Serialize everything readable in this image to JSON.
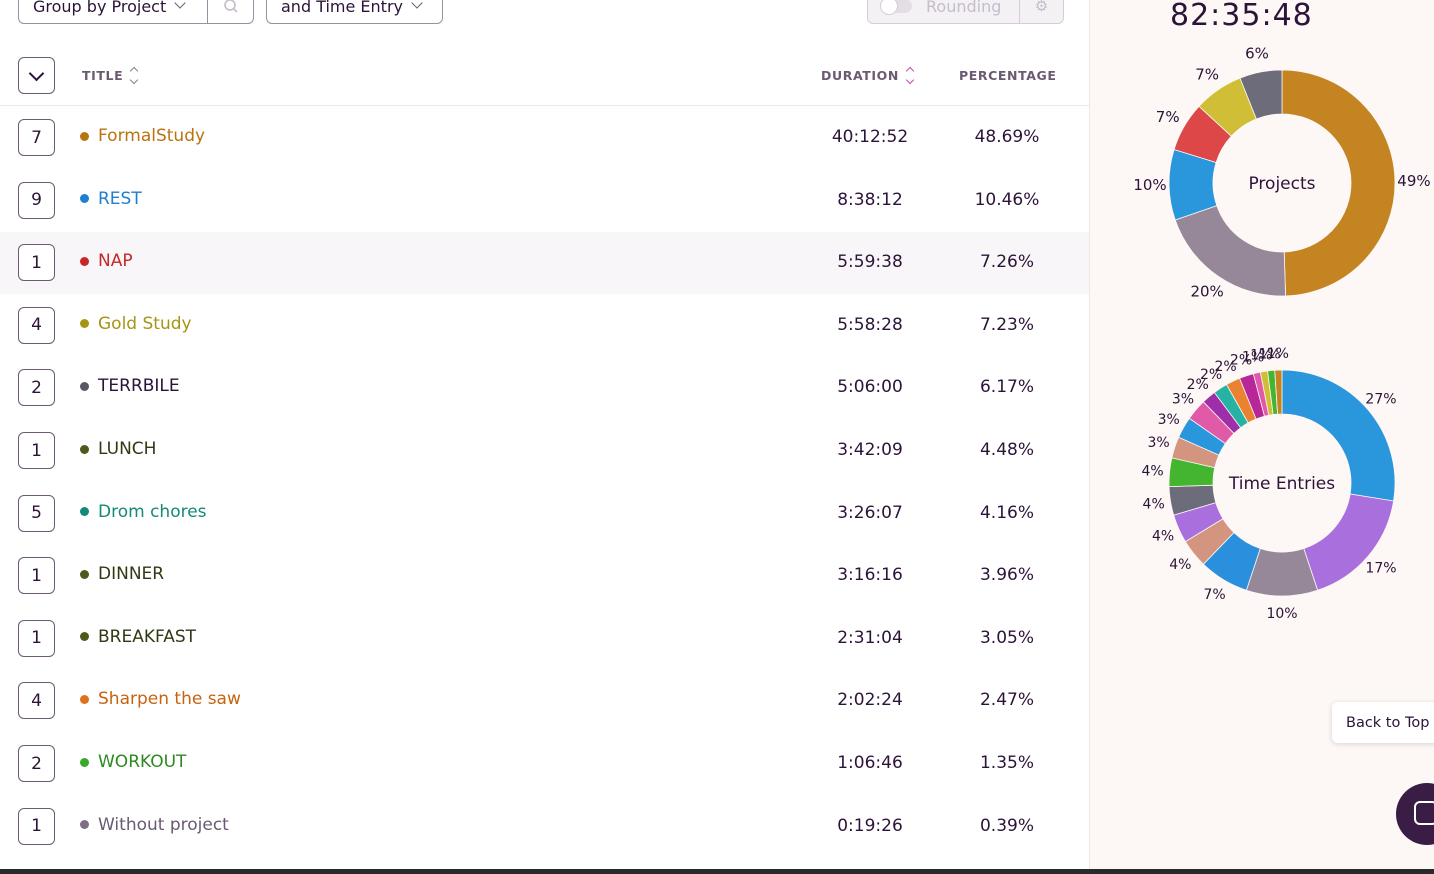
{
  "filters": {
    "group_by": "Group by Project",
    "sub_group": "and Time Entry",
    "rounding": "Rounding"
  },
  "table": {
    "headers": {
      "title": "TITLE",
      "duration": "DURATION",
      "percentage": "PERCENTAGE"
    },
    "rows": [
      {
        "count": "7",
        "name": "FormalStudy",
        "color": "#b9730f",
        "duration": "40:12:52",
        "percentage": "48.69%"
      },
      {
        "count": "9",
        "name": "REST",
        "color": "#1f7ecf",
        "duration": "8:38:12",
        "percentage": "10.46%"
      },
      {
        "count": "1",
        "name": "NAP",
        "color": "#c62828",
        "duration": "5:59:38",
        "percentage": "7.26%"
      },
      {
        "count": "4",
        "name": "Gold Study",
        "color": "#a69414",
        "duration": "5:58:28",
        "percentage": "7.23%"
      },
      {
        "count": "2",
        "name": "TERRBILE",
        "color": "#2c1338",
        "dot": "#5b5866",
        "duration": "5:06:00",
        "percentage": "6.17%"
      },
      {
        "count": "1",
        "name": "LUNCH",
        "color": "#2f3a14",
        "dot": "#4d5a1c",
        "duration": "3:42:09",
        "percentage": "4.48%"
      },
      {
        "count": "5",
        "name": "Drom chores",
        "color": "#128a78",
        "duration": "3:26:07",
        "percentage": "4.16%"
      },
      {
        "count": "1",
        "name": "DINNER",
        "color": "#2f3a14",
        "dot": "#4d5a1c",
        "duration": "3:16:16",
        "percentage": "3.96%"
      },
      {
        "count": "1",
        "name": "BREAKFAST",
        "color": "#2f3a14",
        "dot": "#4d5a1c",
        "duration": "2:31:04",
        "percentage": "3.05%"
      },
      {
        "count": "4",
        "name": "Sharpen the saw",
        "color": "#c7630f",
        "dot": "#e0711b",
        "duration": "2:02:24",
        "percentage": "2.47%"
      },
      {
        "count": "2",
        "name": "WORKOUT",
        "color": "#2c8a1f",
        "dot": "#3aa82a",
        "duration": "1:06:46",
        "percentage": "1.35%"
      },
      {
        "count": "1",
        "name": "Without project",
        "color": "#6b5a72",
        "dot": "#7d6f85",
        "duration": "0:19:26",
        "percentage": "0.39%"
      }
    ]
  },
  "sidebar": {
    "total_time": "82:35:48",
    "back_to_top": "Back to Top"
  },
  "chart_data": [
    {
      "type": "pie",
      "title": "Projects",
      "slices": [
        {
          "label": "49%",
          "value": 49,
          "color": "#c58422"
        },
        {
          "label": "20%",
          "value": 20,
          "color": "#978899"
        },
        {
          "label": "10%",
          "value": 10,
          "color": "#2a96dc"
        },
        {
          "label": "7%",
          "value": 7,
          "color": "#dd4747"
        },
        {
          "label": "7%",
          "value": 7,
          "color": "#d0bf36"
        },
        {
          "label": "6%",
          "value": 6,
          "color": "#6d6c7a"
        }
      ]
    },
    {
      "type": "pie",
      "title": "Time Entries",
      "slices": [
        {
          "label": "27%",
          "value": 27,
          "color": "#2a96dc"
        },
        {
          "label": "17%",
          "value": 17,
          "color": "#a970dd"
        },
        {
          "label": "10%",
          "value": 10,
          "color": "#978899"
        },
        {
          "label": "7%",
          "value": 7,
          "color": "#2a8fdc"
        },
        {
          "label": "4%",
          "value": 4,
          "color": "#d39580"
        },
        {
          "label": "4%",
          "value": 4,
          "color": "#a970dd"
        },
        {
          "label": "4%",
          "value": 4,
          "color": "#6d6c7a"
        },
        {
          "label": "4%",
          "value": 4,
          "color": "#44b52e"
        },
        {
          "label": "3%",
          "value": 3,
          "color": "#d39580"
        },
        {
          "label": "3%",
          "value": 3,
          "color": "#2a96dc"
        },
        {
          "label": "3%",
          "value": 3,
          "color": "#e05aa7"
        },
        {
          "label": "2%",
          "value": 2,
          "color": "#9f2fa8"
        },
        {
          "label": "2%",
          "value": 2,
          "color": "#26b3a3"
        },
        {
          "label": "2%",
          "value": 2,
          "color": "#e98332"
        },
        {
          "label": "2%",
          "value": 2,
          "color": "#b8279a"
        },
        {
          "label": "1%",
          "value": 1,
          "color": "#e05aa7"
        },
        {
          "label": "1%",
          "value": 1,
          "color": "#d0bf36"
        },
        {
          "label": "1%",
          "value": 1,
          "color": "#44b52e"
        },
        {
          "label": "1%",
          "value": 1,
          "color": "#c58422"
        }
      ]
    }
  ]
}
